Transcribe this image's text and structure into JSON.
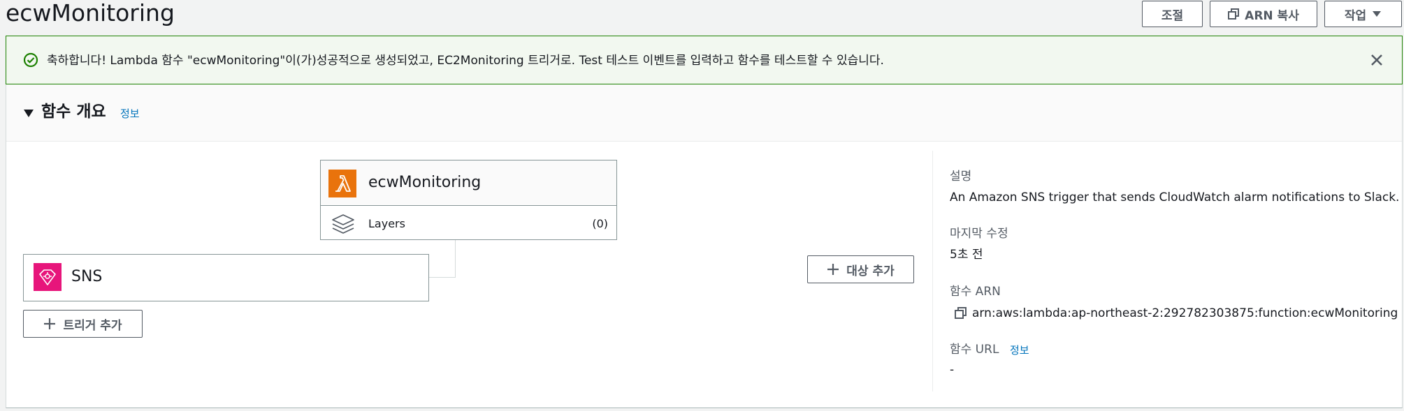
{
  "page": {
    "title": "ecwMonitoring",
    "buttons": {
      "throttle": "조절",
      "copy_arn": "ARN 복사",
      "actions": "작업"
    }
  },
  "flash": {
    "message": "축하합니다! Lambda 함수 \"ecwMonitoring\"이(가)성공적으로 생성되었고, EC2Monitoring 트리거로. Test 테스트 이벤트를 입력하고 함수를 테스트할 수 있습니다.",
    "type": "success",
    "color": "#1d8102"
  },
  "overview": {
    "title": "함수 개요",
    "info": "정보",
    "function": {
      "name": "ecwMonitoring",
      "icon": "lambda-icon",
      "layers_label": "Layers",
      "layers_count": "(0)"
    },
    "trigger": {
      "name": "SNS",
      "icon": "sns-icon"
    },
    "add_trigger": "트리거 추가",
    "add_destination": "대상 추가",
    "details": {
      "description_label": "설명",
      "description": "An Amazon SNS trigger that sends CloudWatch alarm notifications to Slack.",
      "last_modified_label": "마지막 수정",
      "last_modified": "5초 전",
      "arn_label": "함수 ARN",
      "arn": "arn:aws:lambda:ap-northeast-2:292782303875:function:ecwMonitoring",
      "url_label": "함수 URL",
      "url_info": "정보",
      "url": "-"
    }
  },
  "colors": {
    "lambda": "#e9730c",
    "sns": "#e7157b",
    "link": "#0073bb"
  }
}
